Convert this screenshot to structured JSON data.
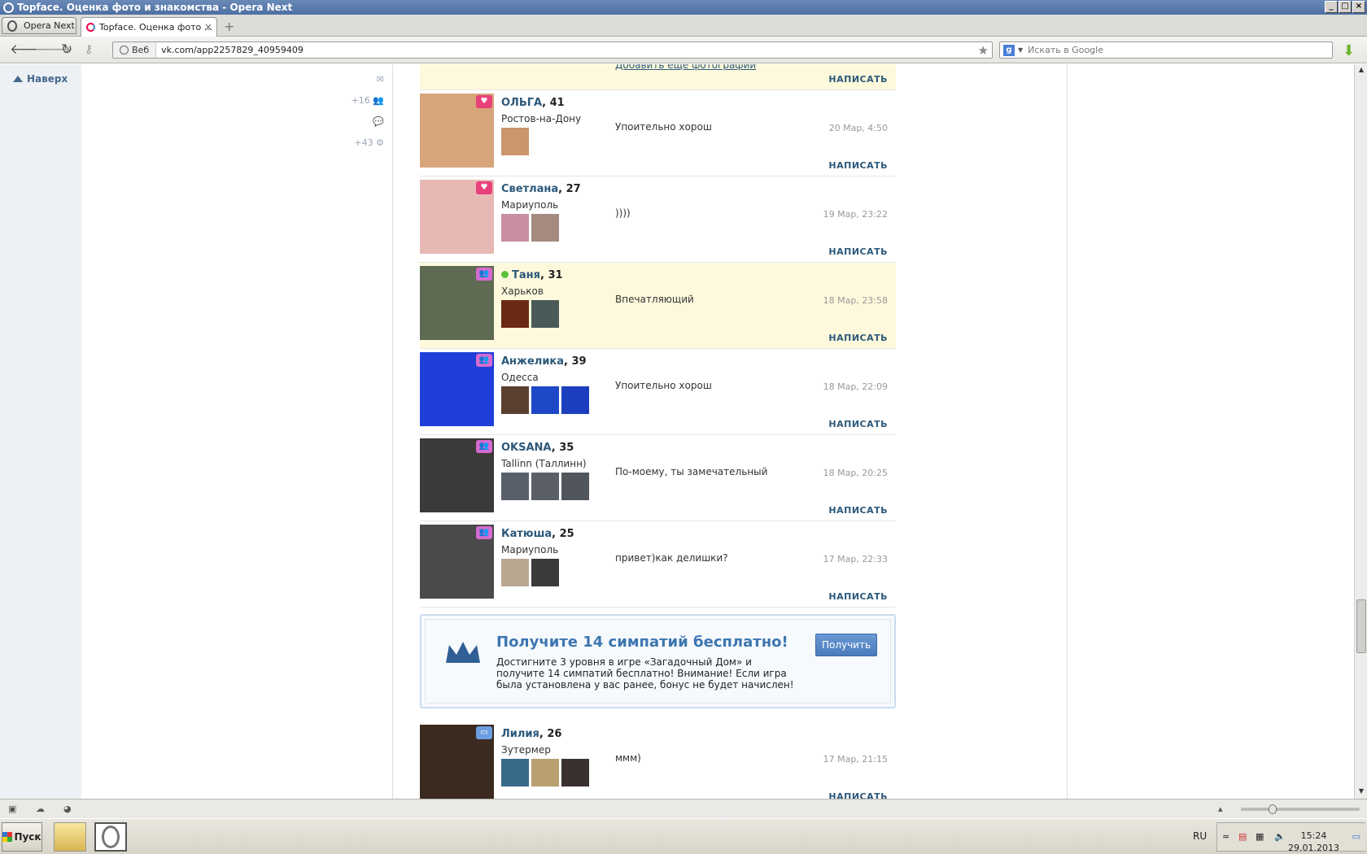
{
  "window": {
    "title": "Topface. Оценка фото и знакомства - Opera Next"
  },
  "tabs": {
    "opera_button": "Opera Next",
    "active_tab": "Topface. Оценка фото ...",
    "close_label": "×",
    "new_tab_label": "+"
  },
  "address_bar": {
    "badge": "Веб",
    "url": "vk.com/app2257829_40959409"
  },
  "search": {
    "engine_icon": "g",
    "placeholder": "Искать в Google"
  },
  "sidebar": {
    "up_label": "Наверх",
    "counter_friends": "+16",
    "counter_settings": "+43"
  },
  "feed": {
    "add_more_photos": "Добавить еще фотографии",
    "write_label": "НАПИСАТЬ",
    "entries": [
      {
        "name": "ОЛЬГА",
        "age": ", 41",
        "city": "Ростов-на-Дону",
        "message": "Упоительно хорош",
        "date": "20 Мар, 4:50",
        "badge": "heart-icon",
        "online": false,
        "highlighted": false,
        "photo_color": "#d7a57a",
        "thumbs": [
          "#c9966e"
        ]
      },
      {
        "name": "Светлана",
        "age": ", 27",
        "city": "Мариуполь",
        "message": "))))",
        "date": "19 Мар, 23:22",
        "badge": "heart-icon",
        "online": false,
        "highlighted": false,
        "photo_color": "#e7b9b4",
        "thumbs": [
          "#c98ea0",
          "#a58a80"
        ]
      },
      {
        "name": "Таня",
        "age": ", 31",
        "city": "Харьков",
        "message": "Впечатляющий",
        "date": "18 Мар, 23:58",
        "badge": "people-icon",
        "online": true,
        "highlighted": true,
        "photo_color": "#5e6b52",
        "thumbs": [
          "#6a2a14",
          "#4a5a58"
        ]
      },
      {
        "name": "Анжелика",
        "age": ", 39",
        "city": "Одесса",
        "message": "Упоительно хорош",
        "date": "18 Мар, 22:09",
        "badge": "people-icon",
        "online": false,
        "highlighted": false,
        "photo_color": "#1f3fd8",
        "thumbs": [
          "#5a4030",
          "#1e48c8",
          "#1d3fbf"
        ]
      },
      {
        "name": "OKSANA",
        "age": ", 35",
        "city": "Tallinn (Таллинн)",
        "message": "По-моему, ты замечательный",
        "date": "18 Мар, 20:25",
        "badge": "people-icon",
        "online": false,
        "highlighted": false,
        "photo_color": "#3c3a38",
        "thumbs": [
          "#57606a",
          "#5b6068",
          "#50565c"
        ]
      },
      {
        "name": "Катюша",
        "age": ", 25",
        "city": "Мариуполь",
        "message": "привет)как делишки?",
        "date": "17 Мар, 22:33",
        "badge": "people-icon",
        "online": false,
        "highlighted": false,
        "photo_color": "#4a4a4a",
        "thumbs": [
          "#b8a890",
          "#3a3a3a"
        ]
      }
    ],
    "promo": {
      "title": "Получите 14 симпатий бесплатно!",
      "text": "Достигните 3 уровня в игре «Загадочный Дом» и получите 14 симпатий бесплатно! Внимание! Если игра была установлена у вас ранее, бонус не будет начислен!",
      "button": "Получить",
      "accent": "#3d76b0"
    },
    "last_entry": {
      "name": "Лилия",
      "age": ", 26",
      "city": "Зутермер",
      "message": "ммм)",
      "date": "17 Мар, 21:15",
      "badge": "chat-icon",
      "photo_color": "#3a2a20",
      "thumbs": [
        "#3a6a8a",
        "#b8a070",
        "#3a3030"
      ]
    }
  },
  "taskbar": {
    "start_label": "Пуск",
    "language": "RU",
    "time": "15:24",
    "date": "29.01.2013"
  }
}
